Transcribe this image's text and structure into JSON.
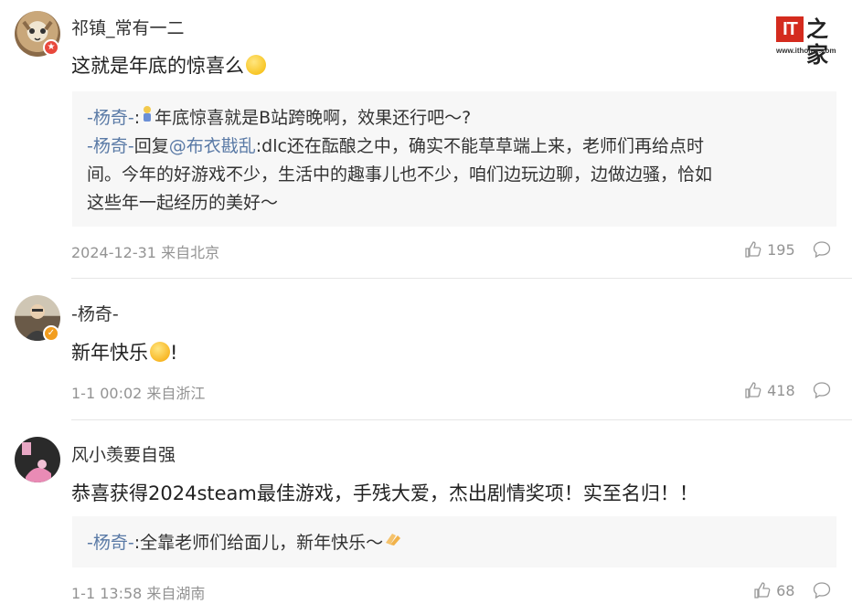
{
  "logo": {
    "it": "IT",
    "zh": "之家",
    "url": "www.ithome.com"
  },
  "comments": [
    {
      "username": "祁镇_常有一二",
      "text": "这就是年底的惊喜么",
      "replies": [
        {
          "user": "-杨奇-",
          "sep": ":",
          "text": "年底惊喜就是B站跨晚啊，效果还行吧～?"
        },
        {
          "user": "-杨奇-",
          "reply_word": "回复",
          "mention": "@布衣戡乱",
          "line1": ":dlc还在酝酿之中，确实不能草草端上来，老师们再给点时",
          "line2": "间。今年的好游戏不少，生活中的趣事儿也不少，咱们边玩边聊，边做边骚，恰如",
          "line3": "这些年一起经历的美好～"
        }
      ],
      "time": "2024-12-31 来自北京",
      "likes": "195"
    },
    {
      "username": "-杨奇-",
      "text": "新年快乐",
      "text_suffix": "!",
      "time": "1-1 00:02 来自浙江",
      "likes": "418"
    },
    {
      "username": "风小羡要自强",
      "text": "恭喜获得2024steam最佳游戏，手残大爱，杰出剧情奖项！实至名归！！",
      "replies": [
        {
          "user": "-杨奇-",
          "sep": ":",
          "text": "全靠老师们给面儿，新年快乐～"
        }
      ],
      "time": "1-1 13:58 来自湖南",
      "likes": "68"
    }
  ]
}
